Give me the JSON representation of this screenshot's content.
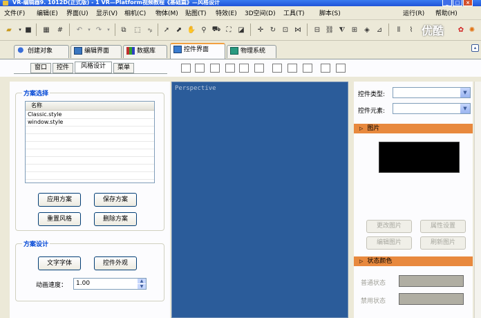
{
  "window": {
    "title": "VR-编辑器9. 1012D(正式版) - 1  VR—Platform视频教程《基础篇》—风格设计"
  },
  "menu": [
    "文件(F)",
    "编辑(E)",
    "界面(U)",
    "显示(V)",
    "相机(C)",
    "物体(M)",
    "贴图(T)",
    "特效(E)",
    "3D空间(D)",
    "工具(T)",
    "脚本(S)",
    "运行(R)",
    "帮助(H)"
  ],
  "watermark": "优酷",
  "main_tabs": [
    "创建对象",
    "编辑界面",
    "数据库",
    "控件界面",
    "物理系统"
  ],
  "sub_tabs": [
    "窗口",
    "控件",
    "风格设计",
    "菜单"
  ],
  "left": {
    "scheme_select": {
      "title": "方案选择",
      "list_header": "名称",
      "items": [
        "Classic.style",
        "window.style"
      ],
      "buttons": {
        "apply": "应用方案",
        "save": "保存方案",
        "reset": "重置风格",
        "delete": "删除方案"
      }
    },
    "scheme_design": {
      "title": "方案设计",
      "buttons": {
        "font": "文字字体",
        "appearance": "控件外观"
      },
      "speed_label": "动画速度：",
      "speed_value": "1.00"
    }
  },
  "viewport": {
    "label": "Perspective"
  },
  "right": {
    "control_type_label": "控件类型:",
    "control_element_label": "控件元素:",
    "picture_section": "图片",
    "buttons": {
      "change_pic": "更改图片",
      "attr": "属性设置",
      "edit_pic": "编辑图片",
      "refresh_pic": "刷新图片"
    },
    "state_color_section": "状态颜色",
    "states": [
      "普通状态",
      "禁用状态"
    ]
  },
  "colors": {
    "viewport_bg": "#2b5c9a",
    "section_bar": "#e8893e",
    "titlebar": "#1f54d8"
  }
}
